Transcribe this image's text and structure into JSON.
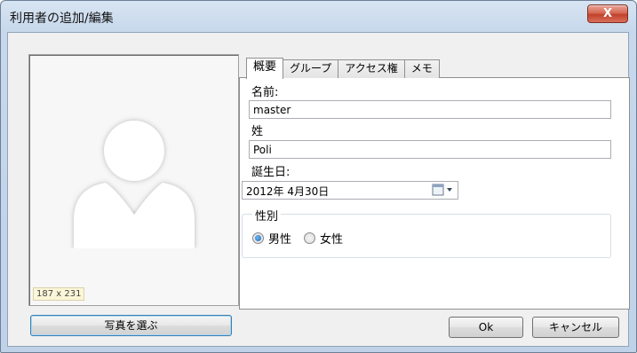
{
  "window": {
    "title": "利用者の追加/編集",
    "close_label": "X"
  },
  "photo": {
    "size_label": "187 x 231",
    "choose_button": "写真を選ぶ"
  },
  "tabs": [
    {
      "label": "概要",
      "active": true
    },
    {
      "label": "グループ",
      "active": false
    },
    {
      "label": "アクセス権",
      "active": false
    },
    {
      "label": "メモ",
      "active": false
    }
  ],
  "form": {
    "first_name_label": "名前:",
    "first_name_value": "master",
    "last_name_label": "姓",
    "last_name_value": "Poli",
    "birthdate_label": "誕生日:",
    "birthdate_value": "2012年  4月30日",
    "gender_label": "性別",
    "gender_options": [
      {
        "label": "男性",
        "checked": true
      },
      {
        "label": "女性",
        "checked": false
      }
    ]
  },
  "buttons": {
    "ok": "Ok",
    "cancel": "キャンセル"
  },
  "icons": {
    "close": "close-icon",
    "calendar": "calendar-dropdown-icon",
    "avatar": "default-user-avatar-icon"
  }
}
